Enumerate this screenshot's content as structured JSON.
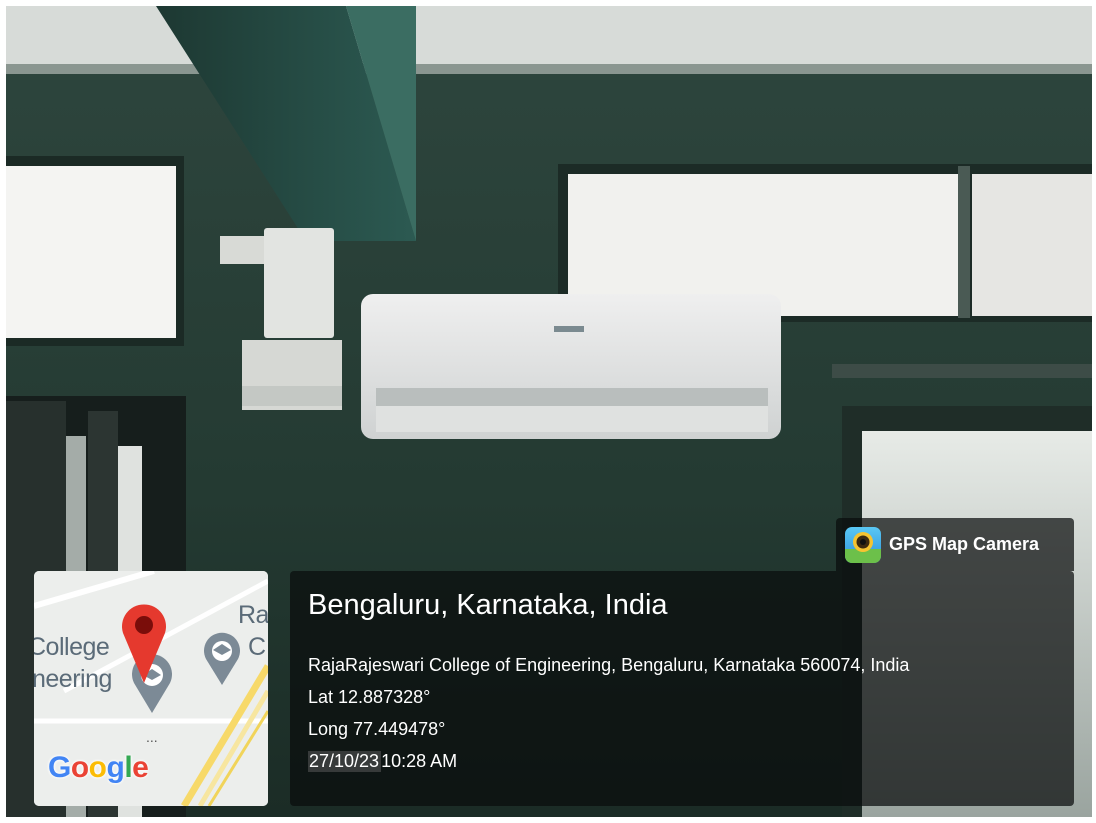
{
  "camera_badge": {
    "label": "GPS Map Camera",
    "icon": "gps-map-camera-app-icon"
  },
  "map": {
    "labels": [
      "College",
      "neering",
      "Ra",
      "C"
    ],
    "logo_letters": [
      "G",
      "o",
      "o",
      "g",
      "l",
      "e"
    ],
    "dots": "..."
  },
  "location": {
    "title": "Bengaluru, Karnataka, India",
    "address": "RajaRajeswari College of Engineering, Bengaluru, Karnataka 560074, India",
    "latitude": "Lat 12.887328°",
    "longitude": "Long 77.449478°",
    "date": "27/10/23",
    "time": "10:28 AM"
  },
  "colors": {
    "wall": "#2a4038",
    "pin": "#e5392e",
    "panel": "#0a0c0c"
  }
}
